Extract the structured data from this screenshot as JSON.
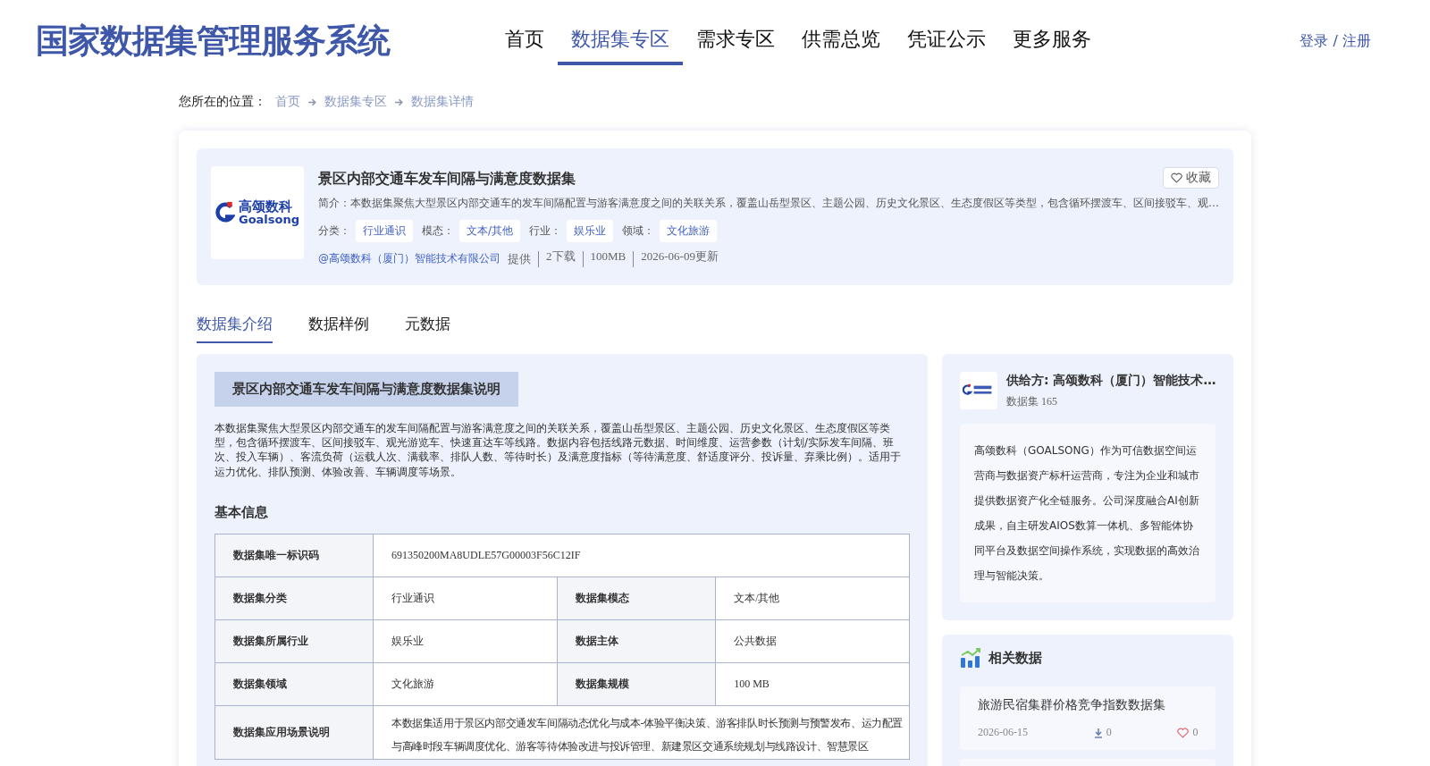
{
  "header": {
    "site_title": "国家数据集管理服务系统",
    "nav": [
      {
        "label": "首页",
        "selected": false
      },
      {
        "label": "数据集专区",
        "selected": true
      },
      {
        "label": "需求专区",
        "selected": false
      },
      {
        "label": "供需总览",
        "selected": false
      },
      {
        "label": "凭证公示",
        "selected": false
      },
      {
        "label": "更多服务",
        "selected": false
      }
    ],
    "login": "登录 / 注册"
  },
  "breadcrumb": {
    "label": "您所在的位置：",
    "items": [
      "首页",
      "数据集专区",
      "数据集详情"
    ]
  },
  "dataset": {
    "logo": {
      "name": "高颂数科",
      "latin": "Goalsong"
    },
    "title": "景区内部交通车发车间隔与满意度数据集",
    "favorite": "收藏",
    "summary": "简介：本数据集聚焦大型景区内部交通车的发车间隔配置与游客满意度之间的关联关系，覆盖山岳型景区、主题公园、历史文化景区、生态度假区等类型，包含循环摆渡车、区间接驳车、观…",
    "tags": [
      {
        "label": "分类：",
        "value": "行业通识"
      },
      {
        "label": "模态：",
        "value": "文本/其他"
      },
      {
        "label": "行业：",
        "value": "娱乐业"
      },
      {
        "label": "领域：",
        "value": "文化旅游"
      }
    ],
    "provider": "@高颂数科（厦门）智能技术有限公司",
    "meta": [
      "提供",
      "2下载",
      "100MB",
      "2026-06-09更新"
    ]
  },
  "tabs": [
    {
      "label": "数据集介绍",
      "selected": true
    },
    {
      "label": "数据样例",
      "selected": false
    },
    {
      "label": "元数据",
      "selected": false
    }
  ],
  "intro": {
    "heading": "景区内部交通车发车间隔与满意度数据集说明",
    "description": "本数据集聚焦大型景区内部交通车的发车间隔配置与游客满意度之间的关联关系，覆盖山岳型景区、主题公园、历史文化景区、生态度假区等类型，包含循环摆渡车、区间接驳车、观光游览车、快速直达车等线路。数据内容包括线路元数据、时间维度、运营参数（计划/实际发车间隔、班次、投入车辆）、客流负荷（运载人次、满载率、排队人数、等待时长）及满意度指标（等待满意度、舒适度评分、投诉量、弃乘比例）。适用于运力优化、排队预测、体验改善、车辆调度等场景。",
    "basic_info_title": "基本信息",
    "rows": [
      [
        {
          "label": "数据集唯一标识码",
          "value": "691350200MA8UDLE57G00003F56C12IF"
        }
      ],
      [
        {
          "label": "数据集分类",
          "value": "行业通识"
        },
        {
          "label": "数据集模态",
          "value": "文本/其他"
        }
      ],
      [
        {
          "label": "数据集所属行业",
          "value": "娱乐业"
        },
        {
          "label": "数据主体",
          "value": "公共数据"
        }
      ],
      [
        {
          "label": "数据集领域",
          "value": "文化旅游"
        },
        {
          "label": "数据集规模",
          "value": "100 MB"
        }
      ],
      [
        {
          "label": "数据集应用场景说明",
          "value": "本数据集适用于景区内部交通发车间隔动态优化与成本-体验平衡决策、游客排队时长预测与预警发布、运力配置与高峰时段车辆调度优化、游客等待体验改进与投诉管理、新建景区交通系统规划与线路设计、智慧景区"
        }
      ]
    ]
  },
  "supplier": {
    "name": "供给方: 高颂数科（厦门）智能技术…",
    "count": "数据集 165",
    "about": "高颂数科（GOALSONG）作为可信数据空间运营商与数据资产标杆运营商，专注为企业和城市提供数据资产化全链服务。公司深度融合AI创新成果，自主研发AIOS数算一体机、多智能体协同平台及数据空间操作系统，实现数据的高效治理与智能决策。"
  },
  "related": {
    "title": "相关数据",
    "items": [
      {
        "title": "旅游民宿集群价格竞争指数数据集",
        "date": "2026-06-15",
        "downloads": "0",
        "likes": "0"
      }
    ]
  }
}
